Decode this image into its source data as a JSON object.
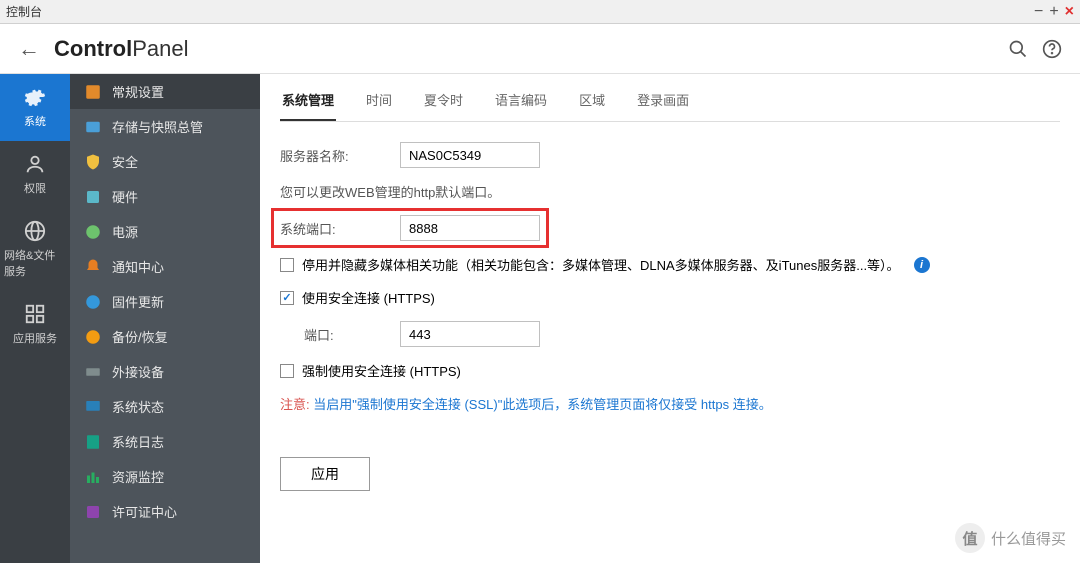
{
  "window": {
    "title": "控制台"
  },
  "header": {
    "brand_bold": "Control",
    "brand_light": "Panel"
  },
  "leftnav": [
    {
      "label": "系统",
      "icon": "gear"
    },
    {
      "label": "权限",
      "icon": "user"
    },
    {
      "label": "网络&文件服务",
      "icon": "globe"
    },
    {
      "label": "应用服务",
      "icon": "apps"
    }
  ],
  "subnav": [
    {
      "label": "常规设置",
      "icon": "settings",
      "active": true
    },
    {
      "label": "存储与快照总管",
      "icon": "storage"
    },
    {
      "label": "安全",
      "icon": "shield"
    },
    {
      "label": "硬件",
      "icon": "hardware"
    },
    {
      "label": "电源",
      "icon": "power"
    },
    {
      "label": "通知中心",
      "icon": "bell"
    },
    {
      "label": "固件更新",
      "icon": "update"
    },
    {
      "label": "备份/恢复",
      "icon": "backup"
    },
    {
      "label": "外接设备",
      "icon": "external"
    },
    {
      "label": "系统状态",
      "icon": "monitor"
    },
    {
      "label": "系统日志",
      "icon": "log"
    },
    {
      "label": "资源监控",
      "icon": "chart"
    },
    {
      "label": "许可证中心",
      "icon": "license"
    }
  ],
  "tabs": [
    "系统管理",
    "时间",
    "夏令时",
    "语言编码",
    "区域",
    "登录画面"
  ],
  "form": {
    "server_name_label": "服务器名称:",
    "server_name_value": "NAS0C5349",
    "port_hint": "您可以更改WEB管理的http默认端口。",
    "system_port_label": "系统端口:",
    "system_port_value": "8888",
    "disable_multimedia_label": "停用并隐藏多媒体相关功能（相关功能包含：多媒体管理、DLNA多媒体服务器、及iTunes服务器...等）。",
    "use_https_label": "使用安全连接 (HTTPS)",
    "https_port_label": "端口:",
    "https_port_value": "443",
    "force_https_label": "强制使用安全连接 (HTTPS)",
    "notice_label": "注意:",
    "notice_text": " 当启用\"强制使用安全连接 (SSL)\"此选项后，系统管理页面将仅接受 https 连接。",
    "apply_label": "应用"
  },
  "watermark": {
    "badge": "值",
    "text": "什么值得买"
  }
}
